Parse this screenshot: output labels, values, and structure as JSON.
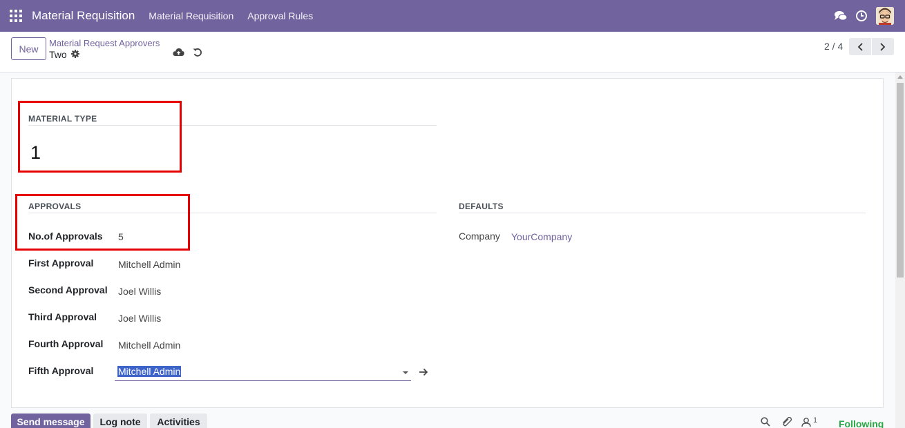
{
  "navbar": {
    "app_name": "Material Requisition",
    "menus": [
      "Material Requisition",
      "Approval Rules"
    ]
  },
  "control_panel": {
    "new_label": "New",
    "breadcrumb": "Material Request Approvers",
    "record_name": "Two",
    "pager": "2 / 4"
  },
  "form": {
    "material_type": {
      "title": "MATERIAL TYPE",
      "value": "1"
    },
    "approvals": {
      "title": "APPROVALS",
      "fields": [
        {
          "label": "No.of Approvals",
          "value": "5"
        },
        {
          "label": "First Approval",
          "value": "Mitchell Admin"
        },
        {
          "label": "Second Approval",
          "value": "Joel Willis"
        },
        {
          "label": "Third Approval",
          "value": "Joel Willis"
        },
        {
          "label": "Fourth Approval",
          "value": "Mitchell Admin"
        },
        {
          "label": "Fifth Approval",
          "value": "Mitchell Admin"
        }
      ]
    },
    "defaults": {
      "title": "DEFAULTS",
      "company_label": "Company",
      "company_value": "YourCompany"
    }
  },
  "chatter": {
    "send_message": "Send message",
    "log_note": "Log note",
    "activities": "Activities",
    "followers_count": "1",
    "following": "Following"
  },
  "colors": {
    "brand": "#71639e",
    "highlight_box": "#e60000",
    "following": "#28a745"
  }
}
